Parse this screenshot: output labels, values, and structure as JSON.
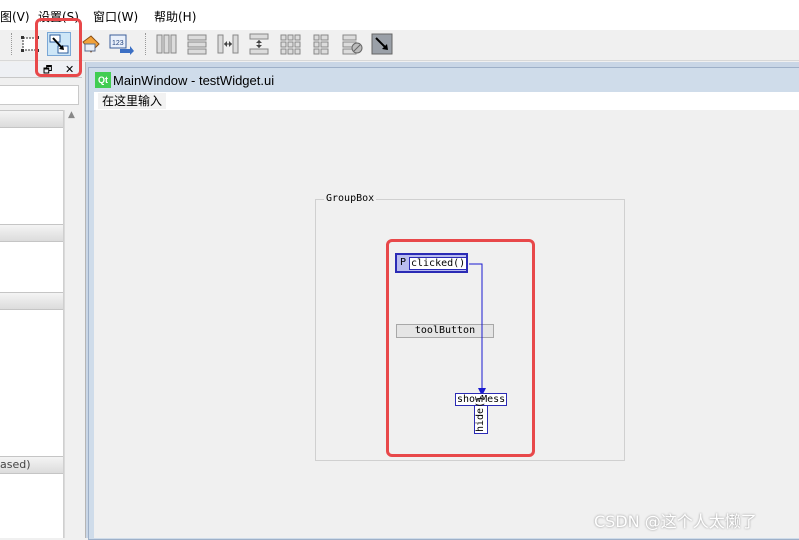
{
  "menubar": {
    "items": [
      {
        "label": "图(V)"
      },
      {
        "label": "设置(S)"
      },
      {
        "label": "窗口(W)"
      },
      {
        "label": "帮助(H)"
      }
    ]
  },
  "toolbar": {
    "buttons": [
      {
        "icon": "edit-widgets-icon"
      },
      {
        "icon": "edit-signals-slots-icon",
        "state": "active"
      },
      {
        "icon": "edit-buddies-icon"
      },
      {
        "icon": "edit-tab-order-icon",
        "label": "123"
      },
      {
        "icon": "layout-horizontal-icon"
      },
      {
        "icon": "layout-vertical-icon"
      },
      {
        "icon": "layout-horizontal-splitter-icon"
      },
      {
        "icon": "layout-vertical-splitter-icon"
      },
      {
        "icon": "layout-grid-icon"
      },
      {
        "icon": "layout-form-icon"
      },
      {
        "icon": "break-layout-icon"
      },
      {
        "icon": "adjust-size-icon"
      }
    ]
  },
  "dock": {
    "float_glyph": "🗗",
    "close_glyph": "✕",
    "partial_text": "ased)"
  },
  "form": {
    "title": "MainWindow - testWidget.ui",
    "logo": "Qt",
    "menu_placeholder": "在这里输入",
    "groupbox_title": "GroupBox",
    "pushbutton_text": "P",
    "signal": "clicked()",
    "toolbutton_text": "toolButton",
    "slot_text": "showMess",
    "slot2_text": "hide()"
  },
  "colors": {
    "highlight": "#e8484a",
    "connection": "#1a1ad0"
  },
  "watermark": "CSDN @这个人太懒了"
}
